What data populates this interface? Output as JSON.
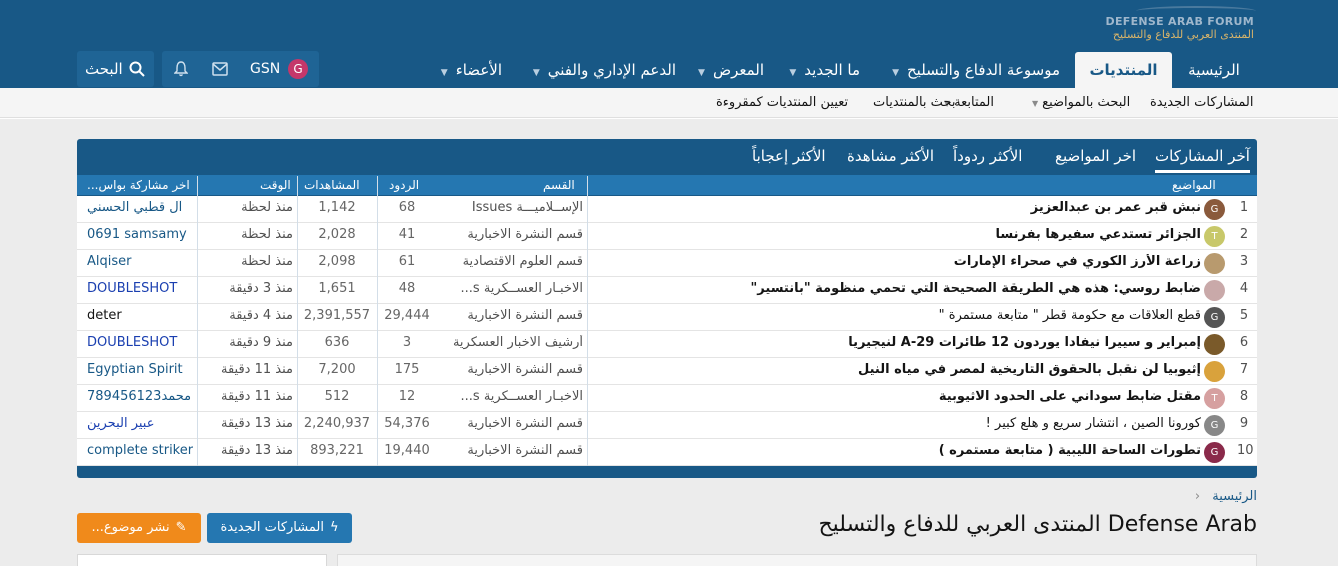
{
  "logo": {
    "line1": "DEFENSE ARAB FORUM",
    "line2": "المنتدى العربي للدفاع والتسليح"
  },
  "nav": {
    "home": "الرئيسية",
    "forums": "المنتديات",
    "encyclopedia": "موسوعة الدفاع والتسليح",
    "whats_new": "ما الجديد",
    "gallery": "المعرض",
    "support": "الدعم الإداري والفني",
    "members": "الأعضاء",
    "user_name": "GSN",
    "user_initial": "G",
    "search": "البحث"
  },
  "subnav": {
    "new_posts": "المشاركات الجديدة",
    "search_threads": "البحث بالمواضيع",
    "following": "المتابعة",
    "search_forums": "بحث بالمنتديات",
    "mark_read": "تعيين المنتديات كمقروءة"
  },
  "widget": {
    "tabs": [
      "آخر المشاركات",
      "اخر المواضيع",
      "الأكثر ردوداً",
      "الأكثر مشاهدة",
      "الأكثر إعجاباً"
    ],
    "headers": {
      "topic": "المواضيع",
      "section": "القسم",
      "replies": "الردود",
      "views": "المشاهدات",
      "time": "الوقت",
      "last_post": "اخر مشاركة بواس..."
    },
    "rows": [
      {
        "n": "1",
        "title": "نبش قبر عمر بن عبدالعزيز",
        "bold": true,
        "section": "الإســلاميـــة Issues",
        "replies": "68",
        "views": "1,142",
        "time": "منذ لحظة",
        "user": "آل قطبي الحسني",
        "user_color": "#185886",
        "avatar": "G",
        "av_color": "#8a5a3c"
      },
      {
        "n": "2",
        "title": "الجزائر تستدعي سفيرها بفرنسا",
        "bold": true,
        "section": "قسم النشرة الاخبارية",
        "replies": "41",
        "views": "2,028",
        "time": "منذ لحظة",
        "user": "0691 samsamy",
        "user_color": "#185886",
        "avatar": "T",
        "av_color": "#c8c86a"
      },
      {
        "n": "3",
        "title": "زراعة الأرز الكوري في صحراء الإمارات",
        "bold": true,
        "section": "قسم العلوم الاقتصادية",
        "replies": "61",
        "views": "2,098",
        "time": "منذ لحظة",
        "user": "Alqiser",
        "user_color": "#185886",
        "avatar": "",
        "av_color": "#b89a6e"
      },
      {
        "n": "4",
        "title": "ضابط روسي: هذه هي الطريقة الصحيحة التي تحمي منظومة \"بانتسير\"",
        "bold": true,
        "section": "الاخبـار العســكرية s...",
        "replies": "48",
        "views": "1,651",
        "time": "منذ 3 دقيقة",
        "user": "DOUBLESHOT",
        "user_color": "#1a3fb0",
        "avatar": "",
        "av_color": "#c9a9a9"
      },
      {
        "n": "5",
        "title": "قطع العلاقات مع حكومة قطر \" متابعة مستمرة \"",
        "bold": false,
        "section": "قسم النشرة الاخبارية",
        "replies": "29,444",
        "views": "2,391,557",
        "time": "منذ 4 دقيقة",
        "user": "deter",
        "user_color": "#141414",
        "avatar": "G",
        "av_color": "#555555"
      },
      {
        "n": "6",
        "title": "إمبراير و سييرا نيفادا يوردون 12 طائرات A-29 لنيجيريا",
        "bold": true,
        "section": "أرشيف الاخبار العسكرية",
        "replies": "3",
        "views": "636",
        "time": "منذ 9 دقيقة",
        "user": "DOUBLESHOT",
        "user_color": "#1a3fb0",
        "avatar": "",
        "av_color": "#7a5a2a"
      },
      {
        "n": "7",
        "title": "إثيوبيا لن نقبل بالحقوق التاريخية لمصر في مياه النيل",
        "bold": true,
        "section": "قسم النشرة الاخبارية",
        "replies": "175",
        "views": "7,200",
        "time": "منذ 11 دقيقة",
        "user": "Egyptian Spirit",
        "user_color": "#185886",
        "avatar": "",
        "av_color": "#d9a23c"
      },
      {
        "n": "8",
        "title": "مقتل ضابط سوداني على الحدود الاثيوبية",
        "bold": true,
        "section": "الاخبـار العســكرية s...",
        "replies": "12",
        "views": "512",
        "time": "منذ 11 دقيقة",
        "user": "محمد789456123",
        "user_color": "#185886",
        "avatar": "T",
        "av_color": "#d6a0a0"
      },
      {
        "n": "9",
        "title": "كورونا الصين ، انتشار سريع و هلع كبير !",
        "bold": false,
        "section": "قسم النشرة الاخبارية",
        "replies": "54,376",
        "views": "2,240,937",
        "time": "منذ 13 دقيقة",
        "user": "عبير البحرين",
        "user_color": "#1a3fb0",
        "avatar": "G",
        "av_color": "#888888"
      },
      {
        "n": "10",
        "title": "تطورات الساحة الليبية ( متابعة مستمره )",
        "bold": true,
        "section": "قسم النشرة الاخبارية",
        "replies": "19,440",
        "views": "893,221",
        "time": "منذ 13 دقيقة",
        "user": "complete striker",
        "user_color": "#185886",
        "avatar": "G",
        "av_color": "#8a2a4a"
      }
    ]
  },
  "breadcrumb": {
    "home": "الرئيسية"
  },
  "page": {
    "title": "Defense Arab المنتدى العربي للدفاع والتسليح",
    "new_posts_button": "المشاركات الجديدة",
    "post_thread_button": "نشر موضوع..."
  },
  "colors": {
    "header": "#185886",
    "accent": "#2577b1",
    "orange": "#f08a1b",
    "avatar": "#c4376a"
  }
}
